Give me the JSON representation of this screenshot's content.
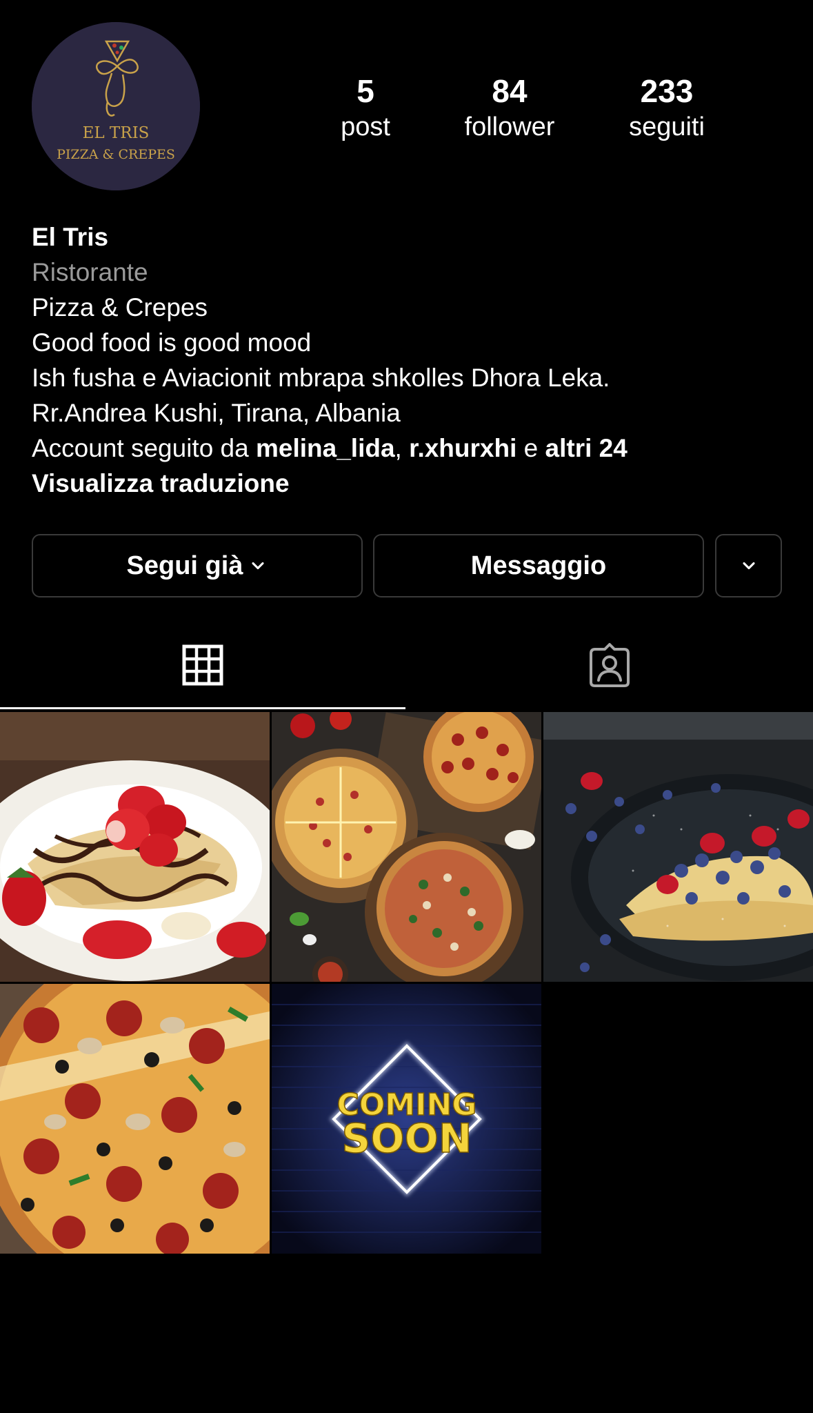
{
  "profile": {
    "avatar_text_1": "EL TRIS",
    "avatar_text_2": "PIZZA & CREPES"
  },
  "stats": {
    "posts": {
      "value": "5",
      "label": "post"
    },
    "followers": {
      "value": "84",
      "label": "follower"
    },
    "following": {
      "value": "233",
      "label": "seguiti"
    }
  },
  "bio": {
    "name": "El Tris",
    "category": "Ristorante",
    "line1": "Pizza & Crepes",
    "line2": "Good food is good mood",
    "line3": "Ish fusha e Aviacionit mbrapa shkolles Dhora Leka.",
    "line4": "Rr.Andrea Kushi, Tirana, Albania",
    "followed_by_prefix": "Account seguito da ",
    "followed_user_1": "melina_lida",
    "followed_sep": ", ",
    "followed_user_2": "r.xhurxhi",
    "followed_and": " e ",
    "followed_others": "altri 24",
    "translate": "Visualizza traduzione"
  },
  "actions": {
    "following_label": "Segui già",
    "message_label": "Messaggio"
  },
  "tabs": {
    "posts_icon": "grid-icon",
    "tagged_icon": "tagged-person-icon"
  },
  "posts": [
    {
      "subject": "crepes-strawberry-chocolate"
    },
    {
      "subject": "pizzas"
    },
    {
      "subject": "crepes-berries"
    },
    {
      "subject": "pizza-slice"
    },
    {
      "subject": "coming-soon-neon",
      "text_1": "COMING",
      "text_2": "SOON"
    }
  ],
  "colors": {
    "background": "#000000",
    "text": "#ffffff",
    "muted": "#9a9a9a",
    "border": "#3a3a3a",
    "neon": "#f4d43c"
  }
}
